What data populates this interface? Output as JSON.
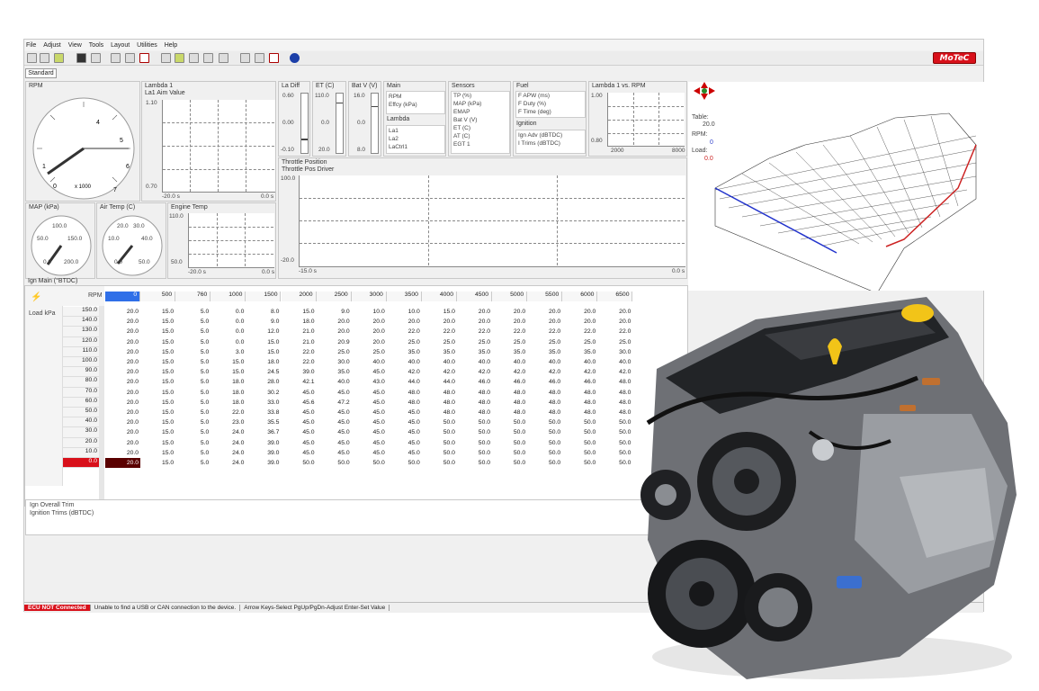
{
  "menu": [
    "File",
    "Adjust",
    "View",
    "Tools",
    "Layout",
    "Utilities",
    "Help"
  ],
  "logo": "MoTeC",
  "tab": "Standard",
  "rpm_gauge": {
    "title": "RPM",
    "unit": "x 1000",
    "ticks": [
      "0",
      "1",
      "2",
      "3",
      "4",
      "5",
      "6",
      "7"
    ]
  },
  "lambda1": {
    "title": "Lambda 1",
    "subtitle": "La1 Aim Value",
    "ymax": "1.10",
    "ymin": "0.70",
    "tstart": "-20.0 s",
    "tend": "0.0 s"
  },
  "la_diff": {
    "title": "La Diff",
    "top": "0.60",
    "mid": "0.00",
    "bot": "-0.10"
  },
  "et": {
    "title": "ET (C)",
    "top": "110.0",
    "mid": "0.0",
    "bot": "20.0"
  },
  "batv": {
    "title": "Bat V (V)",
    "top": "16.0",
    "mid": "0.0",
    "bot": "8.0"
  },
  "main_list": {
    "title": "Main",
    "items": [
      "RPM",
      "Effcy (kPa)"
    ]
  },
  "lambda_list": {
    "title": "Lambda",
    "items": [
      "La1",
      "La2",
      "LaCtrl1"
    ]
  },
  "sensors": {
    "title": "Sensors",
    "items": [
      "TP (%)",
      "MAP (kPa)",
      "EMAP",
      "Bat V (V)",
      "ET (C)",
      "AT (C)",
      "EGT 1"
    ]
  },
  "fuel": {
    "title": "Fuel",
    "items": [
      "F APW (ms)",
      "F Duty (%)",
      "F Time (deg)"
    ]
  },
  "ignition": {
    "title": "Ignition",
    "items": [
      "Ign Adv (dBTDC)",
      "I Trims (dBTDC)"
    ]
  },
  "lambda_rpm": {
    "title": "Lambda 1 vs. RPM",
    "ymax": "1.00",
    "ymin": "0.80",
    "xmin": "2000",
    "xmax": "8000"
  },
  "throttle": {
    "title": "Throttle Position",
    "subtitle": "Throttle Pos Driver",
    "ymax": "100.0",
    "ymin": "-20.0",
    "tstart": "-15.0 s",
    "tend": "0.0 s"
  },
  "map_gauge": {
    "title": "MAP (kPa)",
    "labels": [
      "100.0",
      "50.0",
      "150.0",
      "0.0",
      "200.0"
    ]
  },
  "air_gauge": {
    "title": "Air Temp (C)",
    "labels": [
      "20.0",
      "30.0",
      "10.0",
      "40.0",
      "0.0",
      "50.0"
    ]
  },
  "engine_temp": {
    "title": "Engine Temp",
    "ymax": "110.0",
    "ymin": "50.0",
    "tstart": "-20.0 s",
    "tend": "0.0 s"
  },
  "table3d": {
    "table_label": "Table:",
    "table_val": "20.0",
    "rpm_label": "RPM:",
    "rpm_val": "0",
    "load_label": "Load:",
    "load_val": "0.0"
  },
  "ign_table": {
    "title": "Ign Main (°BTDC)",
    "rpm_label": "RPM",
    "load_label": "Load kPa",
    "rpm_bins": [
      "0",
      "500",
      "760",
      "1000",
      "1500",
      "2000",
      "2500",
      "3000",
      "3500",
      "4000",
      "4500",
      "5000",
      "5500",
      "6000",
      "6500"
    ],
    "load_bins": [
      "150.0",
      "140.0",
      "130.0",
      "120.0",
      "110.0",
      "100.0",
      "90.0",
      "80.0",
      "70.0",
      "60.0",
      "50.0",
      "40.0",
      "30.0",
      "20.0",
      "10.0",
      "0.0"
    ],
    "rows": [
      [
        "20.0",
        "15.0",
        "5.0",
        "0.0",
        "8.0",
        "15.0",
        "9.0",
        "10.0",
        "10.0",
        "15.0",
        "20.0",
        "20.0",
        "20.0",
        "20.0",
        "20.0"
      ],
      [
        "20.0",
        "15.0",
        "5.0",
        "0.0",
        "9.0",
        "18.0",
        "20.0",
        "20.0",
        "20.0",
        "20.0",
        "20.0",
        "20.0",
        "20.0",
        "20.0",
        "20.0"
      ],
      [
        "20.0",
        "15.0",
        "5.0",
        "0.0",
        "12.0",
        "21.0",
        "20.0",
        "20.0",
        "22.0",
        "22.0",
        "22.0",
        "22.0",
        "22.0",
        "22.0",
        "22.0"
      ],
      [
        "20.0",
        "15.0",
        "5.0",
        "0.0",
        "15.0",
        "21.0",
        "20.9",
        "20.0",
        "25.0",
        "25.0",
        "25.0",
        "25.0",
        "25.0",
        "25.0",
        "25.0"
      ],
      [
        "20.0",
        "15.0",
        "5.0",
        "3.0",
        "15.0",
        "22.0",
        "25.0",
        "25.0",
        "35.0",
        "35.0",
        "35.0",
        "35.0",
        "35.0",
        "35.0",
        "30.0"
      ],
      [
        "20.0",
        "15.0",
        "5.0",
        "15.0",
        "18.0",
        "22.0",
        "30.0",
        "40.0",
        "40.0",
        "40.0",
        "40.0",
        "40.0",
        "40.0",
        "40.0",
        "40.0"
      ],
      [
        "20.0",
        "15.0",
        "5.0",
        "15.0",
        "24.5",
        "39.0",
        "35.0",
        "45.0",
        "42.0",
        "42.0",
        "42.0",
        "42.0",
        "42.0",
        "42.0",
        "42.0"
      ],
      [
        "20.0",
        "15.0",
        "5.0",
        "18.0",
        "28.0",
        "42.1",
        "40.0",
        "43.0",
        "44.0",
        "44.0",
        "46.0",
        "46.0",
        "46.0",
        "46.0",
        "48.0"
      ],
      [
        "20.0",
        "15.0",
        "5.0",
        "18.0",
        "30.2",
        "45.0",
        "45.0",
        "45.0",
        "48.0",
        "48.0",
        "48.0",
        "48.0",
        "48.0",
        "48.0",
        "48.0"
      ],
      [
        "20.0",
        "15.0",
        "5.0",
        "18.0",
        "33.0",
        "45.6",
        "47.2",
        "45.0",
        "48.0",
        "48.0",
        "48.0",
        "48.0",
        "48.0",
        "48.0",
        "48.0"
      ],
      [
        "20.0",
        "15.0",
        "5.0",
        "22.0",
        "33.8",
        "45.0",
        "45.0",
        "45.0",
        "45.0",
        "48.0",
        "48.0",
        "48.0",
        "48.0",
        "48.0",
        "48.0"
      ],
      [
        "20.0",
        "15.0",
        "5.0",
        "23.0",
        "35.5",
        "45.0",
        "45.0",
        "45.0",
        "45.0",
        "50.0",
        "50.0",
        "50.0",
        "50.0",
        "50.0",
        "50.0"
      ],
      [
        "20.0",
        "15.0",
        "5.0",
        "24.0",
        "36.7",
        "45.0",
        "45.0",
        "45.0",
        "45.0",
        "50.0",
        "50.0",
        "50.0",
        "50.0",
        "50.0",
        "50.0"
      ],
      [
        "20.0",
        "15.0",
        "5.0",
        "24.0",
        "39.0",
        "45.0",
        "45.0",
        "45.0",
        "45.0",
        "50.0",
        "50.0",
        "50.0",
        "50.0",
        "50.0",
        "50.0"
      ],
      [
        "20.0",
        "15.0",
        "5.0",
        "24.0",
        "39.0",
        "45.0",
        "45.0",
        "45.0",
        "45.0",
        "50.0",
        "50.0",
        "50.0",
        "50.0",
        "50.0",
        "50.0"
      ],
      [
        "20.0",
        "15.0",
        "5.0",
        "24.0",
        "39.0",
        "50.0",
        "50.0",
        "50.0",
        "50.0",
        "50.0",
        "50.0",
        "50.0",
        "50.0",
        "50.0",
        "50.0"
      ]
    ]
  },
  "bottom_panel": {
    "line1": "Ign Overall Trim",
    "line2": "Ignition Trims (dBTDC)"
  },
  "status": {
    "err": "ECU NOT Connected",
    "msg1": "Unable to find a USB or CAN connection to the device.",
    "msg2": "Arrow Keys-Select  PgUp/PgDn-Adjust  Enter-Set Value"
  },
  "colors": {
    "accent": "#2f6fe8",
    "error": "#d8101a",
    "dark_cell": "#5a0000"
  }
}
